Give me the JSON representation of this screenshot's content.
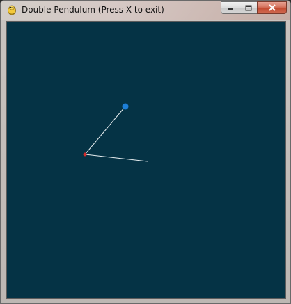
{
  "window": {
    "title": "Double Pendulum (Press X to exit)",
    "icon": "python-snake-icon",
    "controls": [
      "minimize-icon",
      "maximize-icon",
      "close-icon"
    ]
  },
  "canvas": {
    "background": "#053345"
  },
  "pendulum": {
    "pivot_color": "#1e7fd6",
    "joint_color": "#d42a2a",
    "rod_color": "#e8eef0"
  }
}
